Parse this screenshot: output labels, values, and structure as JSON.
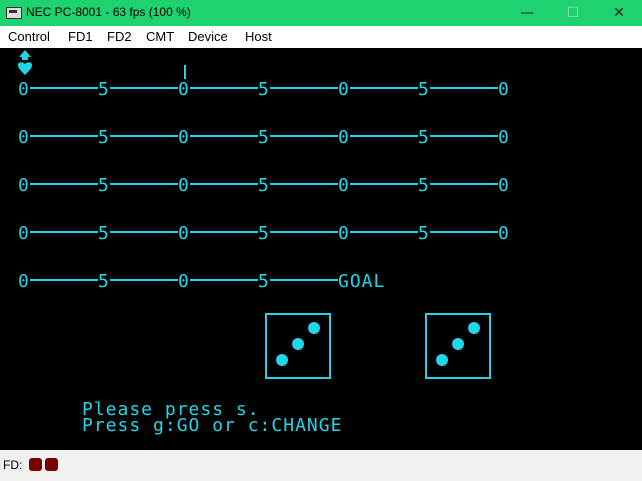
{
  "window": {
    "title": "NEC PC-8001 - 63 fps (100 %)",
    "controls": {
      "minimize": "—",
      "maximize": "☐",
      "close": "✕"
    }
  },
  "menu": {
    "items": [
      "Control",
      "FD1",
      "FD2",
      "CMT",
      "Device",
      "Host"
    ]
  },
  "screen": {
    "track_rows": [
      [
        "0",
        "5",
        "0",
        "5",
        "0",
        "5",
        "0"
      ],
      [
        "0",
        "5",
        "0",
        "5",
        "0",
        "5",
        "0"
      ],
      [
        "0",
        "5",
        "0",
        "5",
        "0",
        "5",
        "0"
      ],
      [
        "0",
        "5",
        "0",
        "5",
        "0",
        "5",
        "0"
      ],
      [
        "0",
        "5",
        "0",
        "5",
        "GOAL"
      ]
    ],
    "dice": [
      3,
      3
    ],
    "message_line1": "Please press s.",
    "message_line2": "Press g:GO or c:CHANGE"
  },
  "colors": {
    "screen_fg": "#22d6e8",
    "screen_bg": "#000000",
    "titlebar": "#1fd270",
    "led": "#7a0000"
  },
  "status": {
    "label": "FD:",
    "drive_leds": 2
  }
}
